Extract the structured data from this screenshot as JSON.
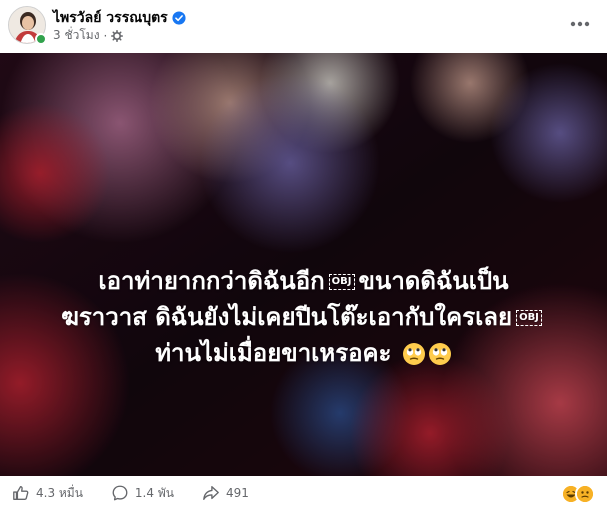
{
  "post": {
    "author_name": "ไพรวัลย์ วรรณบุตร",
    "verified_icon": "verified-badge-icon",
    "timestamp": "3 ชั่วโมง",
    "separator": "·",
    "privacy_icon": "globe-gear-icon",
    "more_icon": "more-horizontal-icon"
  },
  "media": {
    "line1_a": "เอาท่ายากกว่าดิฉันอีก",
    "line1_obj": "OBJ",
    "line1_b": "ขนาดดิฉันเป็น",
    "line2_a": "ฆราวาส ดิฉันยังไม่เคยปีนโต๊ะเอากับใครเลย",
    "line2_obj": "OBJ",
    "line3": "ท่านไม่เมื่อยขาเหรอคะ",
    "emoji_icon": "face-with-rolling-eyes-icon"
  },
  "footer": {
    "likes": "4.3 หมื่น",
    "comments": "1.4 พัน",
    "shares": "491",
    "like_icon": "thumbs-up-icon",
    "comment_icon": "comment-bubble-icon",
    "share_icon": "share-arrow-icon"
  },
  "colors": {
    "link_blue": "#1877f2",
    "online_green": "#31a24c",
    "meta_gray": "#65676b"
  }
}
